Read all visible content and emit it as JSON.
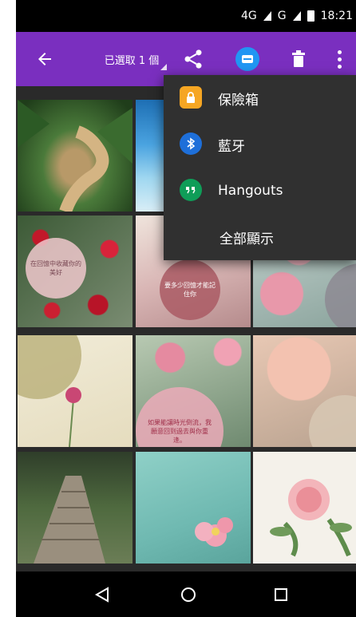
{
  "status_bar": {
    "network": "4G",
    "network_sup": "4G",
    "signal2": "G",
    "time": "18:21",
    "icons": [
      "signal-icon",
      "signal-icon",
      "battery-icon"
    ]
  },
  "action_bar": {
    "selection_label": "已選取 1 個",
    "icons": [
      "back-arrow-icon",
      "share-icon",
      "message-icon",
      "trash-icon",
      "more-vert-icon"
    ],
    "accent_color": "#7a2fbf"
  },
  "menu": {
    "items": [
      {
        "label": "保險箱",
        "icon": "lock-icon",
        "icon_color": "#f6a623"
      },
      {
        "label": "藍牙",
        "icon": "bluetooth-icon",
        "icon_color": "#1e6fd9"
      },
      {
        "label": "Hangouts",
        "icon": "hangouts-icon",
        "icon_color": "#0f9d58"
      },
      {
        "label": "全部顯示",
        "icon": "",
        "icon_color": ""
      }
    ]
  },
  "grid": {
    "overlay_texts": [
      "在回憶中收藏你的美好",
      "要多少回憶才能記住你",
      "",
      "",
      "如果能讓時光倒流，我願意回到過去與你重逢。",
      "",
      "",
      "",
      ""
    ]
  },
  "nav_bar": {
    "icons": [
      "nav-back-icon",
      "nav-home-icon",
      "nav-recent-icon"
    ]
  }
}
